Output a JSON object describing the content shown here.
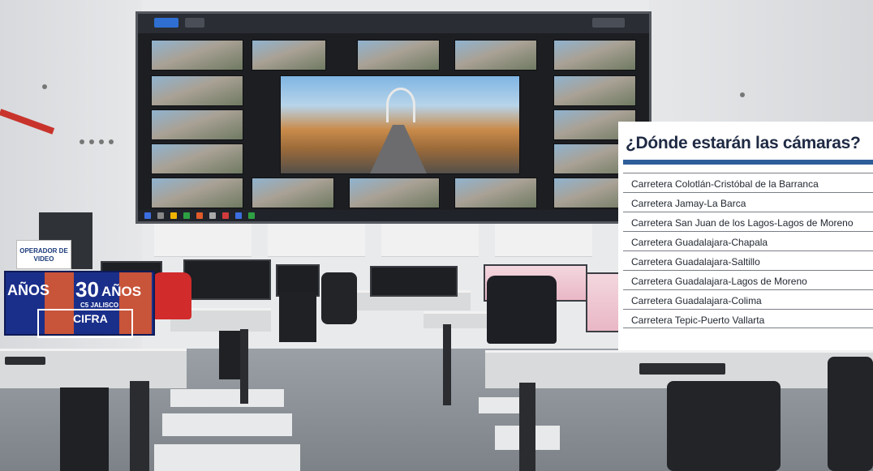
{
  "infobox": {
    "title": "¿Dónde estarán las cámaras?",
    "roads": [
      "Carretera Colotlán-Cristóbal de la Barranca",
      "Carretera Jamay-La Barca",
      "Carretera San Juan de los Lagos-Lagos de Moreno",
      "Carretera Guadalajara-Chapala",
      "Carretera Guadalajara-Saltillo",
      "Carretera Guadalajara-Lagos de Moreno",
      "Carretera Guadalajara-Colima",
      "Carretera Tepic-Puerto Vallarta"
    ]
  },
  "photo": {
    "sign_text": "OPERADOR DE VIDEO",
    "logo": {
      "number": "30",
      "word": "AÑOS",
      "sub": "C5 JALISCO",
      "brand": "CIFRA"
    },
    "colors": {
      "accent_blue": "#2e5e99",
      "title_navy": "#1f2a44",
      "logo_blue": "#1a2f8a",
      "logo_orange": "#e85a2a"
    }
  }
}
